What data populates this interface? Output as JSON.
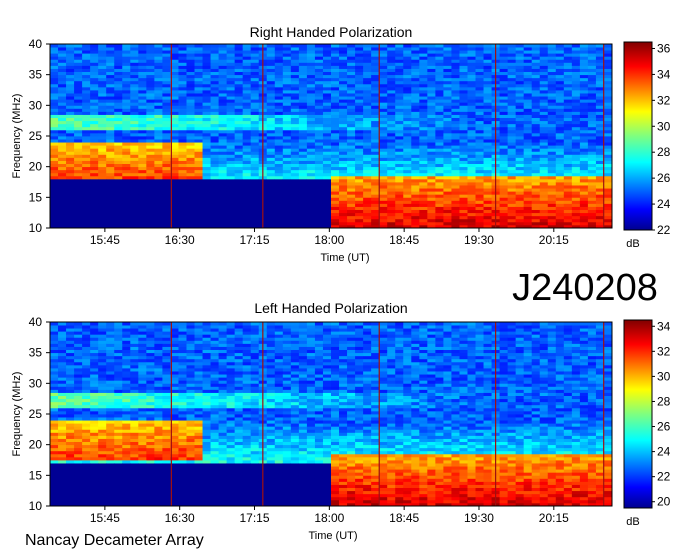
{
  "figure": {
    "observation_id": "J240208",
    "instrument": "Nancay Decameter Array"
  },
  "chart_data": [
    {
      "type": "heatmap",
      "title": "Right Handed Polarization",
      "xlabel": "Time (UT)",
      "ylabel": "Frequency (MHz)",
      "x_ticks": [
        "15:45",
        "16:30",
        "17:15",
        "18:00",
        "18:45",
        "19:30",
        "20:15"
      ],
      "y_ticks": [
        10,
        15,
        20,
        25,
        30,
        35,
        40
      ],
      "ylim": [
        10,
        40
      ],
      "xlim": [
        "15:12",
        "20:50"
      ],
      "colorbar": {
        "label": "dB",
        "ticks": [
          22,
          24,
          26,
          28,
          30,
          32,
          34,
          36
        ],
        "range": [
          22,
          36.5
        ]
      },
      "colors": {
        "low": "#000080",
        "high": "#800000"
      },
      "features": {
        "low_band_cutoff_mhz": 17.8,
        "low_band_cutoff_end_time": "18:00",
        "vertical_lines": [
          "16:25",
          "17:20",
          "18:30",
          "19:40",
          "20:45"
        ]
      }
    },
    {
      "type": "heatmap",
      "title": "Left Handed Polarization",
      "xlabel": "Time (UT)",
      "ylabel": "Frequency (MHz)",
      "x_ticks": [
        "15:45",
        "16:30",
        "17:15",
        "18:00",
        "18:45",
        "19:30",
        "20:15"
      ],
      "y_ticks": [
        10,
        15,
        20,
        25,
        30,
        35,
        40
      ],
      "ylim": [
        10,
        40
      ],
      "xlim": [
        "15:12",
        "20:50"
      ],
      "colorbar": {
        "label": "dB",
        "ticks": [
          20,
          22,
          24,
          26,
          28,
          30,
          32,
          34
        ],
        "range": [
          19.5,
          34.5
        ]
      },
      "colors": {
        "low": "#000080",
        "high": "#800000"
      },
      "features": {
        "low_band_cutoff_mhz": 17.0,
        "low_band_cutoff_end_time": "18:00",
        "vertical_lines": [
          "16:25",
          "17:20",
          "18:30",
          "19:40",
          "20:45"
        ]
      }
    }
  ]
}
